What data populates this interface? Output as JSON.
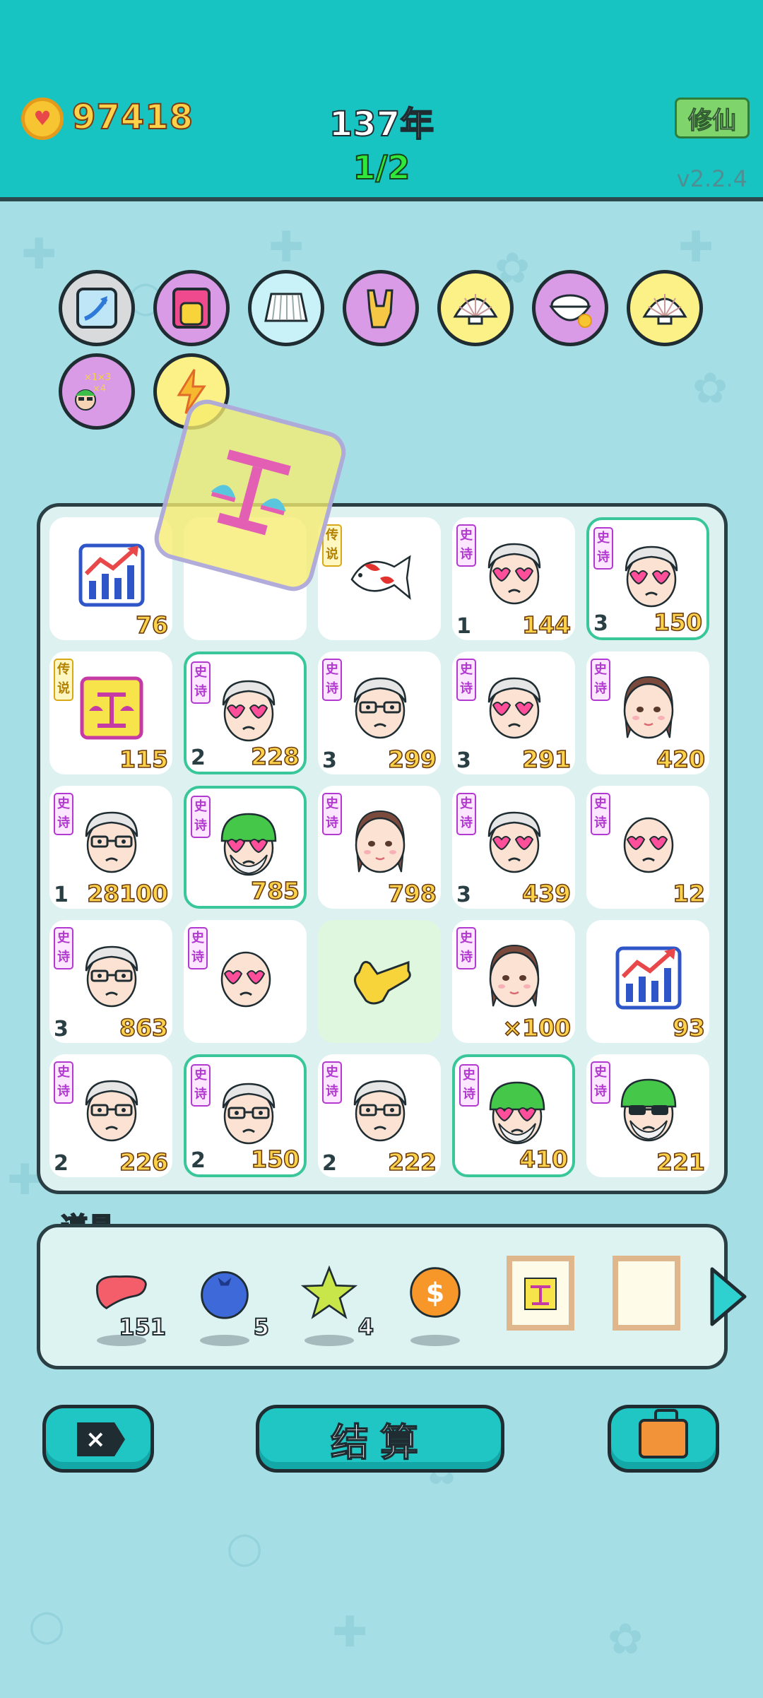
{
  "header": {
    "coins": "97418",
    "year": "137年",
    "wave": "1/2",
    "cultivate_label": "修仙",
    "version": "v2.2.4"
  },
  "buffs": [
    {
      "icon": "arrow-curve-icon",
      "bg": "#d8dadb"
    },
    {
      "icon": "yellow-mascot-icon",
      "bg": "#d99ae6"
    },
    {
      "icon": "pleated-skirt-icon",
      "bg": "#c8f1f8"
    },
    {
      "icon": "rock-hand-icon",
      "bg": "#d99ae6"
    },
    {
      "icon": "seashell-icon",
      "bg": "#fbf186"
    },
    {
      "icon": "rice-bowl-icon",
      "bg": "#d99ae6"
    },
    {
      "icon": "seashell-icon",
      "bg": "#fbf186"
    },
    {
      "icon": "math-guy-icon",
      "bg": "#d99ae6"
    },
    {
      "icon": "lightning-icon",
      "bg": "#fbf186"
    }
  ],
  "board": [
    [
      {
        "type": "chart",
        "count": "76"
      },
      {
        "type": "empty"
      },
      {
        "type": "koi",
        "tag": "传说",
        "tag_color": "gold"
      },
      {
        "type": "grandpa-heart",
        "tag": "史诗",
        "level": "1",
        "count": "144"
      },
      {
        "type": "grandpa-heart",
        "tag": "史诗",
        "level": "3",
        "count": "150",
        "highlight": true
      }
    ],
    [
      {
        "type": "scale",
        "tag": "传说",
        "tag_color": "gold",
        "count": "115"
      },
      {
        "type": "grandpa-heart",
        "tag": "史诗",
        "level": "2",
        "count": "228",
        "highlight": true
      },
      {
        "type": "grandpa-glasses",
        "tag": "史诗",
        "level": "3",
        "count": "299"
      },
      {
        "type": "grandpa-heart",
        "tag": "史诗",
        "level": "3",
        "count": "291"
      },
      {
        "type": "girl-braids",
        "tag": "史诗",
        "count": "420"
      }
    ],
    [
      {
        "type": "grandpa-glasses",
        "tag": "史诗",
        "level": "1",
        "count": "28100"
      },
      {
        "type": "green-hat-heart",
        "tag": "史诗",
        "count": "785",
        "highlight": true
      },
      {
        "type": "girl-braids",
        "tag": "史诗",
        "count": "798"
      },
      {
        "type": "grandpa-heart",
        "tag": "史诗",
        "level": "3",
        "count": "439"
      },
      {
        "type": "bald-heart",
        "tag": "史诗",
        "count": "12"
      }
    ],
    [
      {
        "type": "grandpa-glasses",
        "tag": "史诗",
        "level": "3",
        "count": "863"
      },
      {
        "type": "bald-heart",
        "tag": "史诗"
      },
      {
        "type": "pointing-hand",
        "green": true
      },
      {
        "type": "girl-braids",
        "tag": "史诗",
        "count": "×100"
      },
      {
        "type": "chart",
        "count": "93"
      }
    ],
    [
      {
        "type": "grandpa-glasses",
        "tag": "史诗",
        "level": "2",
        "count": "226"
      },
      {
        "type": "grandpa-glasses",
        "tag": "史诗",
        "level": "2",
        "count": "150",
        "highlight": true
      },
      {
        "type": "grandpa-glasses",
        "tag": "史诗",
        "level": "2",
        "count": "222"
      },
      {
        "type": "green-hat-heart",
        "tag": "史诗",
        "count": "410",
        "highlight": true
      },
      {
        "type": "green-hat-sunglasses",
        "tag": "史诗",
        "count": "221"
      }
    ]
  ],
  "items": {
    "label": "道具",
    "list": [
      {
        "icon": "liver-icon",
        "count": "151"
      },
      {
        "icon": "blueberry-icon",
        "count": "5"
      },
      {
        "icon": "star-icon",
        "count": "4"
      },
      {
        "icon": "dollar-coin-icon"
      },
      {
        "icon": "scale-frame-icon"
      },
      {
        "icon": "empty-frame-icon"
      }
    ]
  },
  "buttons": {
    "delete_label": "×",
    "settle_label": "结算",
    "bag_icon": "briefcase-icon"
  },
  "overlay_icon": "balance-tag-icon"
}
